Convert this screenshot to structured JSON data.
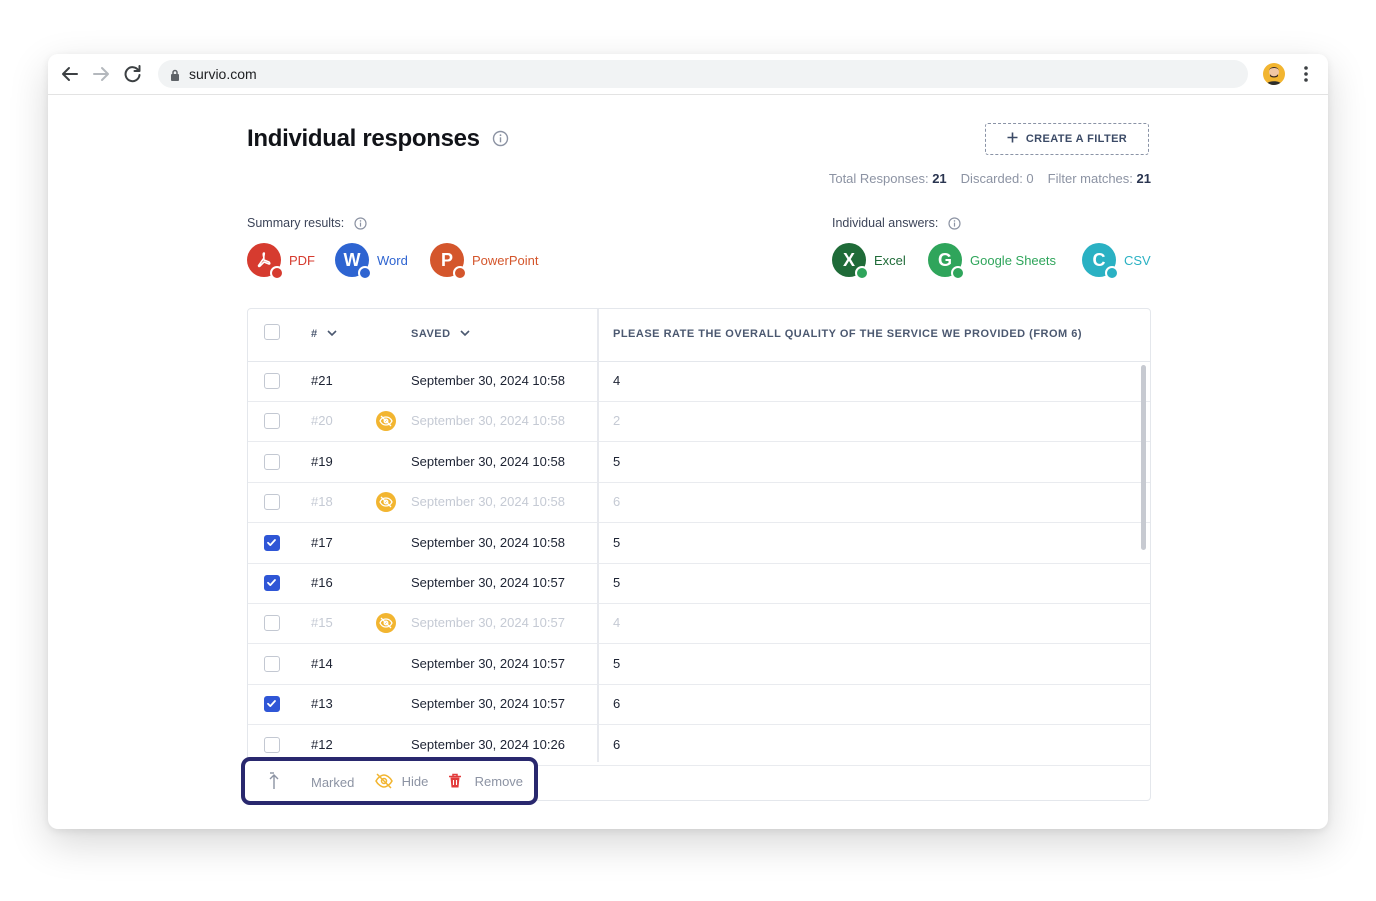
{
  "browser": {
    "url": "survio.com"
  },
  "page": {
    "title": "Individual responses",
    "filter_button": "CREATE A FILTER",
    "stats": {
      "total_label": "Total Responses:",
      "total": "21",
      "discarded": "Discarded: 0",
      "matches_label": "Filter matches:",
      "matches": "21"
    }
  },
  "summary": {
    "label": "Summary results:",
    "items": [
      {
        "label": "PDF",
        "letter": "",
        "color": "#d63b2f"
      },
      {
        "label": "Word",
        "letter": "W",
        "color": "#2e64d1"
      },
      {
        "label": "PowerPoint",
        "letter": "P",
        "color": "#d4562c"
      }
    ]
  },
  "individual": {
    "label": "Individual answers:",
    "items": [
      {
        "label": "Excel",
        "letter": "X",
        "color": "#1f6b38"
      },
      {
        "label": "Google Sheets",
        "letter": "G",
        "color": "#2fa55b"
      },
      {
        "label": "CSV",
        "letter": "C",
        "color": "#2ab1c3"
      }
    ]
  },
  "table": {
    "headers": {
      "number": "#",
      "saved": "SAVED",
      "question": "PLEASE RATE THE OVERALL QUALITY OF THE SERVICE WE PROVIDED (FROM 6)"
    },
    "rows": [
      {
        "num": "#21",
        "date": "September 30, 2024 10:58",
        "value": "4",
        "checked": false,
        "hidden": false
      },
      {
        "num": "#20",
        "date": "September 30, 2024 10:58",
        "value": "2",
        "checked": false,
        "hidden": true
      },
      {
        "num": "#19",
        "date": "September 30, 2024 10:58",
        "value": "5",
        "checked": false,
        "hidden": false
      },
      {
        "num": "#18",
        "date": "September 30, 2024 10:58",
        "value": "6",
        "checked": false,
        "hidden": true
      },
      {
        "num": "#17",
        "date": "September 30, 2024 10:58",
        "value": "5",
        "checked": true,
        "hidden": false
      },
      {
        "num": "#16",
        "date": "September 30, 2024 10:57",
        "value": "5",
        "checked": true,
        "hidden": false
      },
      {
        "num": "#15",
        "date": "September 30, 2024 10:57",
        "value": "4",
        "checked": false,
        "hidden": true
      },
      {
        "num": "#14",
        "date": "September 30, 2024 10:57",
        "value": "5",
        "checked": false,
        "hidden": false
      },
      {
        "num": "#13",
        "date": "September 30, 2024 10:57",
        "value": "6",
        "checked": true,
        "hidden": false
      },
      {
        "num": "#12",
        "date": "September 30, 2024 10:26",
        "value": "6",
        "checked": false,
        "hidden": false
      }
    ]
  },
  "actions": {
    "marked": "Marked",
    "hide": "Hide",
    "remove": "Remove"
  }
}
